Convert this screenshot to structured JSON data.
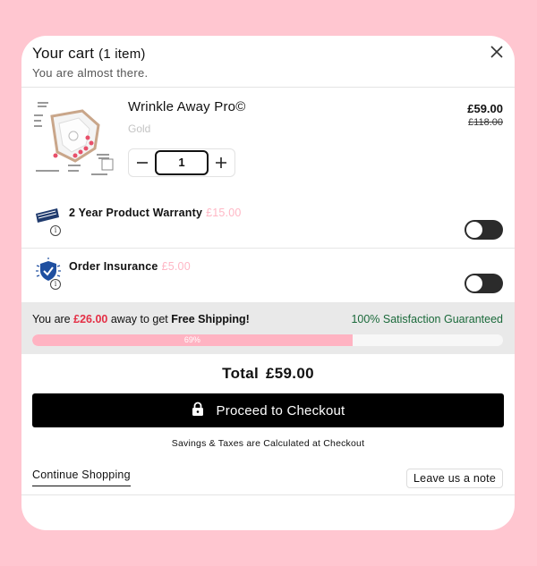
{
  "header": {
    "title": "Your cart",
    "count": "(1 item)",
    "subtitle": "You are almost there."
  },
  "product": {
    "name": "Wrinkle Away Pro©",
    "variant": "Gold",
    "price": "£59.00",
    "compare_price": "£118.00",
    "quantity": "1"
  },
  "addons": [
    {
      "label": "2 Year Product Warranty",
      "price": "£15.00",
      "enabled": false,
      "icon": "warranty-badge-icon"
    },
    {
      "label": "Order Insurance",
      "price": "£5.00",
      "enabled": false,
      "icon": "shield-check-icon"
    }
  ],
  "shipping": {
    "prefix": "You are",
    "amount": "£26.00",
    "middle": "away to get",
    "free_label": "Free Shipping!",
    "guarantee": "100% Satisfaction Guaranteed",
    "progress_percent": 68,
    "progress_label": "69%"
  },
  "total": {
    "label": "Total",
    "amount": "£59.00"
  },
  "checkout": {
    "label": "Proceed to Checkout",
    "savings_note": "Savings & Taxes are Calculated at Checkout"
  },
  "footer": {
    "continue_label": "Continue Shopping",
    "note_label": "Leave us a note"
  },
  "colors": {
    "background": "#ffc6d0",
    "accent_pink": "#ffb3c2",
    "shipping_amount": "#e43046",
    "guarantee": "#1b6a3b"
  }
}
